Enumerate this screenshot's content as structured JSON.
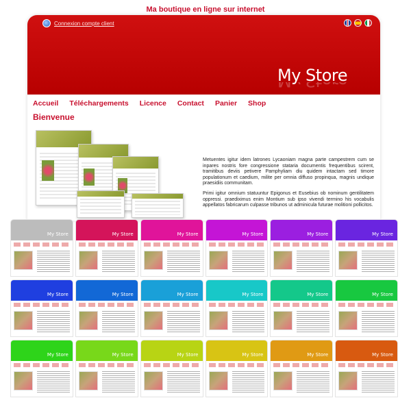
{
  "caption": "Ma boutique en ligne sur internet",
  "header": {
    "login_link": "Connexion compte client",
    "store_title": "My Store",
    "flags": [
      "en",
      "es",
      "it"
    ]
  },
  "nav": {
    "items": [
      "Accueil",
      "Téléchargements",
      "Licence",
      "Contact",
      "Panier",
      "Shop"
    ]
  },
  "page_title": "Bienvenue",
  "content": {
    "para1": "Metuentes igitur idem latrones Lycaoniam magna parte campestrem cum se inpares nostris fore congressione stataria documentis frequentibus scirent, tramitibus deviis petivere Pamphyliam diu quidem intactam sed timore populationum et caedium, milite per omnia diffuso propinqua, magnis undique praesidiis communitam.",
    "para2": "Primi igitur omnium statuuntur Epigonus et Eusebius ob nominum gentilitatem oppressi. praediximus enim Montium sub ipso vivendi termino his vocabulis appellatos fabricarum culpasse tribunos ut adminicula futurae molitioni pollicitos."
  },
  "thumbnails": {
    "store_title": "My Store",
    "colors": [
      "#bcbcbc",
      "#d4145a",
      "#e0149a",
      "#c415d6",
      "#9b1fe0",
      "#6a25e0",
      "#1f3fe0",
      "#1268d6",
      "#1aa0d8",
      "#18c8c8",
      "#14c88a",
      "#18c840",
      "#2ed41a",
      "#78d81a",
      "#b8d414",
      "#d8c414",
      "#e09a14",
      "#d85a10"
    ]
  }
}
